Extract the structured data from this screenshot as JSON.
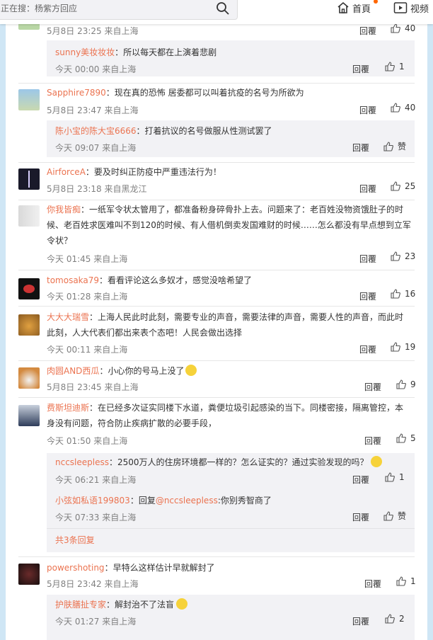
{
  "search": {
    "text": "正在搜：杨紫方回应"
  },
  "nav": {
    "home": "首頁",
    "video": "视频"
  },
  "actions": {
    "reply": "回覆"
  },
  "comments": [
    {
      "meta": "5月8日 23:25 来自上海",
      "likes": "40"
    },
    {
      "user": "sunny美妆妆妆",
      "text": "：所以每天都在上演着悲剧",
      "meta": "今天 00:00 来自上海",
      "likes": "1"
    },
    {
      "user": "Sapphire7890",
      "text": "：现在真的恐怖 居委都可以叫着抗疫的名号为所欲为",
      "meta": "5月8日 23:47 来自上海",
      "likes": "40"
    },
    {
      "user": "陈小宝的陈大宝6666",
      "text": "：打着抗议的名号做服从性测试罢了",
      "meta": "今天 09:07 来自上海",
      "likes": "赞"
    },
    {
      "user": "AirforceA",
      "text": "：要及时纠正防疫中严重违法行为！",
      "meta": "5月8日 23:18 来自黑龙江",
      "likes": "25"
    },
    {
      "user": "你我皆痴",
      "text": "：一纸军令状太管用了，都准备粉身碎骨扑上去。问题来了：老百姓没物资饿肚子的时候、老百姓求医难叫不到120的时候、有人借机倒卖发国难财的时候……怎么都没有早点想到立军令状？",
      "meta": "今天 01:45 来自上海",
      "likes": "23"
    },
    {
      "user": "tomosaka79",
      "text": "：看看评论这么多奴才，感觉没啥希望了",
      "meta": "今天 01:28 来自上海",
      "likes": "16"
    },
    {
      "user": "大大大瑞雪",
      "text": "：上海人民此时此刻，需要专业的声音，需要法律的声音，需要人性的声音，而此时此刻，人大代表们都出来表个态吧！人民会做出选择",
      "meta": "今天 00:11 来自上海",
      "likes": "19"
    },
    {
      "user": "肉圆AND西瓜",
      "text": "：小心你的号马上没了",
      "meta": "5月8日 23:45 来自上海",
      "likes": "9"
    },
    {
      "user": "费斯坦迪斯",
      "text": "：在已经多次证实同楼下水道，粪便垃圾引起感染的当下。同楼密接，隔离管控，本身没有问题，符合防止疾病扩散的必要手段，",
      "meta": "今天 01:50 来自上海",
      "likes": "5"
    },
    {
      "user": "nccsleepless",
      "text": "：2500万人的住房环境都一样的？怎么证实的？通过实验发现的吗？",
      "meta": "今天 06:21 来自上海",
      "likes": "1"
    },
    {
      "user": "小弦如私语199803",
      "text": "：回复",
      "mention": "@nccsleepless",
      "text2": ":你别秀智商了",
      "meta": "今天 07:33 来自上海",
      "likes": "赞"
    },
    {
      "more": "共3条回复"
    },
    {
      "user": "powershoting",
      "text": "：早特么这样估计早就解封了",
      "meta": "5月8日 23:42 来自上海",
      "likes": "1"
    },
    {
      "user": "护肤膳扯专家",
      "text": "：解封治不了法盲",
      "meta": "今天 01:27 来自上海",
      "likes": "2"
    }
  ]
}
